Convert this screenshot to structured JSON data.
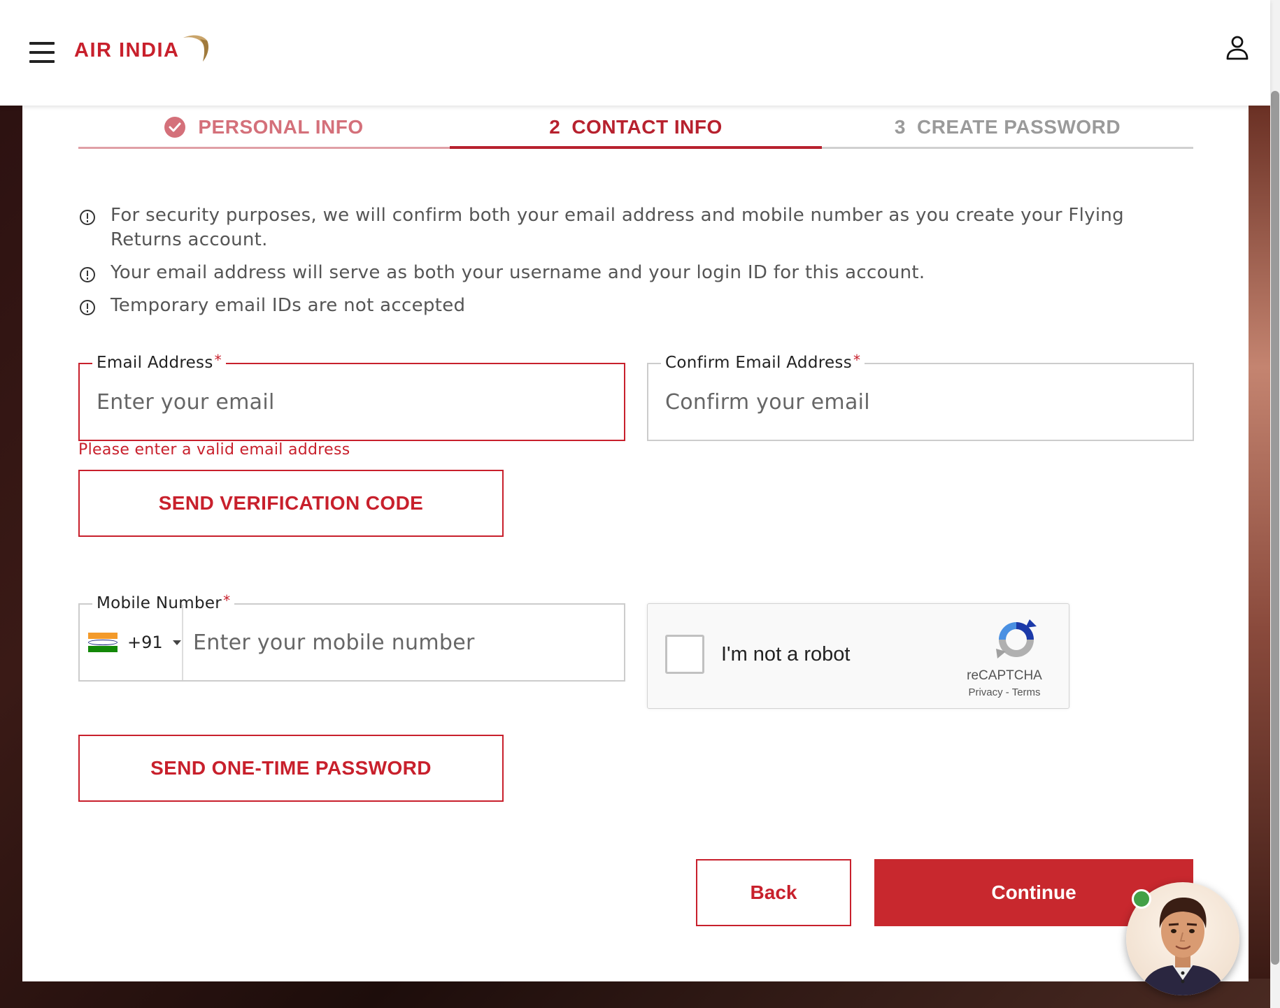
{
  "header": {
    "logo_text": "AIR INDIA",
    "menu_icon": "hamburger-menu-icon",
    "profile_icon": "user-icon"
  },
  "steps": [
    {
      "number": "",
      "label": "PERSONAL INFO",
      "state": "completed"
    },
    {
      "number": "2",
      "label": "CONTACT INFO",
      "state": "active"
    },
    {
      "number": "3",
      "label": "CREATE PASSWORD",
      "state": "upcoming"
    }
  ],
  "info": [
    "For security purposes, we will confirm both your email address and mobile number as you create your Flying Returns account.",
    "Your email address will serve as both your username and your login ID for this account.",
    "Temporary email IDs are not accepted"
  ],
  "email": {
    "label": "Email Address",
    "required_mark": "*",
    "placeholder": "Enter your email",
    "value": "",
    "error": "Please enter a valid email address"
  },
  "confirm_email": {
    "label": "Confirm Email Address",
    "required_mark": "*",
    "placeholder": "Confirm your email",
    "value": ""
  },
  "send_verification_label": "SEND VERIFICATION CODE",
  "mobile": {
    "label": "Mobile Number",
    "required_mark": "*",
    "country_code": "+91",
    "country_flag": "india-flag-icon",
    "placeholder": "Enter your mobile number",
    "value": ""
  },
  "send_otp_label": "SEND ONE-TIME PASSWORD",
  "recaptcha": {
    "label": "I'm not a robot",
    "brand": "reCAPTCHA",
    "privacy": "Privacy",
    "separator": " - ",
    "terms": "Terms"
  },
  "actions": {
    "back_label": "Back",
    "continue_label": "Continue"
  },
  "colors": {
    "brand_red": "#c8202c",
    "completed_step": "#d4707a",
    "upcoming_step": "#9a9a9a",
    "online_status": "#43a047"
  }
}
